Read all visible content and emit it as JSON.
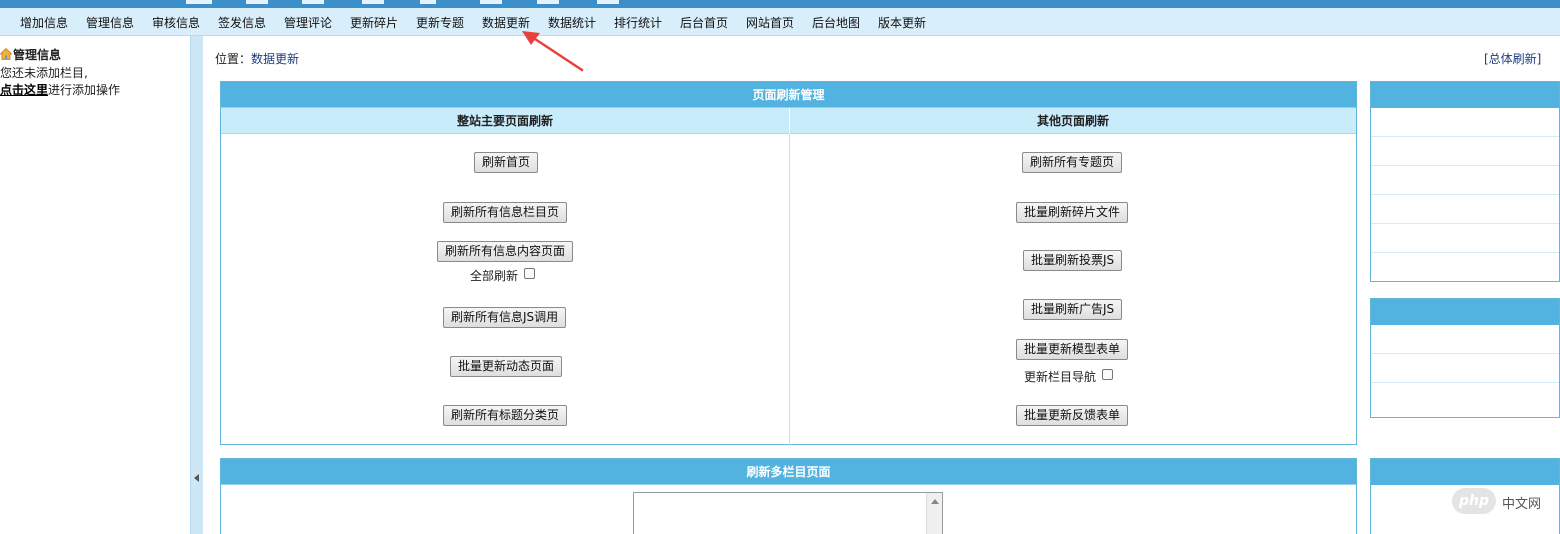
{
  "menu": {
    "items": [
      "增加信息",
      "管理信息",
      "审核信息",
      "签发信息",
      "管理评论",
      "更新碎片",
      "更新专题",
      "数据更新",
      "数据统计",
      "排行统计",
      "后台首页",
      "网站首页",
      "后台地图",
      "版本更新"
    ]
  },
  "sidebar": {
    "title": "管理信息",
    "line1": "您还未添加栏目,",
    "link": "点击这里",
    "line2_rest": "进行添加操作"
  },
  "location": {
    "prefix": "位置：",
    "current": "数据更新"
  },
  "refresh_all": "[总体刷新]",
  "refresh_panel": {
    "title": "页面刷新管理",
    "left_header": "整站主要页面刷新",
    "right_header": "其他页面刷新",
    "left_buttons": [
      "刷新首页",
      "刷新所有信息栏目页",
      "刷新所有信息内容页面",
      "刷新所有信息JS调用",
      "批量更新动态页面",
      "刷新所有标题分类页"
    ],
    "left_checkbox_label": "全部刷新",
    "right_buttons": [
      "刷新所有专题页",
      "批量刷新碎片文件",
      "批量刷新投票JS",
      "批量刷新广告JS",
      "批量更新模型表单",
      "批量更新反馈表单"
    ],
    "right_checkbox_label": "更新栏目导航"
  },
  "multi_panel": {
    "title": "刷新多栏目页面"
  },
  "watermark": {
    "badge": "php",
    "text": "中文网"
  },
  "colors": {
    "header_blue": "#52b3e0",
    "menubar_bg": "#d8eefb",
    "accent_arrow": "#e8403a"
  }
}
